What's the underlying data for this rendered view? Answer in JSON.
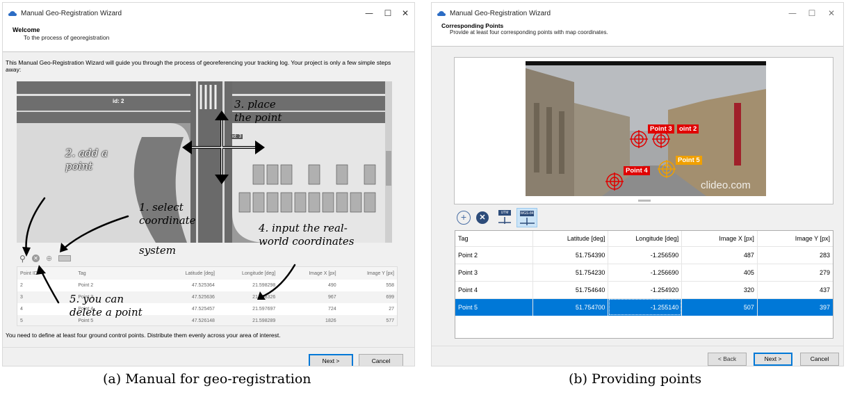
{
  "left": {
    "window_title": "Manual Geo-Registration Wizard",
    "header_title": "Welcome",
    "header_subtitle": "To the process of georegistration",
    "intro": "This Manual Geo-Registration Wizard will guide you through the process of georeferencing your tracking log. Your project is only a few simple steps away:",
    "map_labels": {
      "id2": "id: 2",
      "id3": "id: 3"
    },
    "annotations": {
      "place": [
        "3. place",
        "the point"
      ],
      "add": [
        "2. add a",
        "point"
      ],
      "select": [
        "1. select",
        "coordinate",
        "system"
      ],
      "input": [
        "4. input the real-",
        "world coordinates"
      ],
      "delete": [
        "5. you can",
        "delete a point"
      ]
    },
    "columns": [
      "Point ID",
      "Tag",
      "Latitude [deg]",
      "Longitude [deg]",
      "Image X [px]",
      "Image Y [px]"
    ],
    "rows": [
      [
        "2",
        "Point 2",
        "47.525364",
        "21.598298",
        "490",
        "558"
      ],
      [
        "3",
        "Point 3",
        "47.525636",
        "21.598326",
        "967",
        "699"
      ],
      [
        "4",
        "Point 4",
        "47.525457",
        "21.597697",
        "724",
        "27"
      ],
      [
        "5",
        "Point 5",
        "47.526148",
        "21.598289",
        "1826",
        "577"
      ]
    ],
    "footer_note": "You need to define at least four ground control points. Distribute them evenly across your area of interest.",
    "next_label": "Next >",
    "cancel_label": "Cancel"
  },
  "right": {
    "window_title": "Manual Geo-Registration Wizard",
    "header_title": "Corresponding Points",
    "header_subtitle": "Provide at least four corresponding points with map coordinates.",
    "markers": [
      "Point 3",
      "oint 2",
      "Point 4",
      "Point 5"
    ],
    "watermark": "clideo.com",
    "toolbar": {
      "utm": "UTM",
      "wgs": "WGS-84"
    },
    "columns": [
      "Tag",
      "Latitude [deg]",
      "Longitude [deg]",
      "Image X [px]",
      "Image Y [px]"
    ],
    "rows": [
      [
        "Point 2",
        "51.754390",
        "-1.256590",
        "487",
        "283"
      ],
      [
        "Point 3",
        "51.754230",
        "-1.256690",
        "405",
        "279"
      ],
      [
        "Point 4",
        "51.754640",
        "-1.254920",
        "320",
        "437"
      ],
      [
        "Point 5",
        "51.754700",
        "-1.255140",
        "507",
        "397"
      ]
    ],
    "selected_row": 3,
    "back_label": "< Back",
    "next_label": "Next >",
    "cancel_label": "Cancel"
  },
  "captions": {
    "a": "(a) Manual for geo-registration",
    "b": "(b) Providing points"
  },
  "colors": {
    "selection": "#0078d7",
    "marker_red": "#e00000",
    "marker_orange": "#f0a000"
  }
}
